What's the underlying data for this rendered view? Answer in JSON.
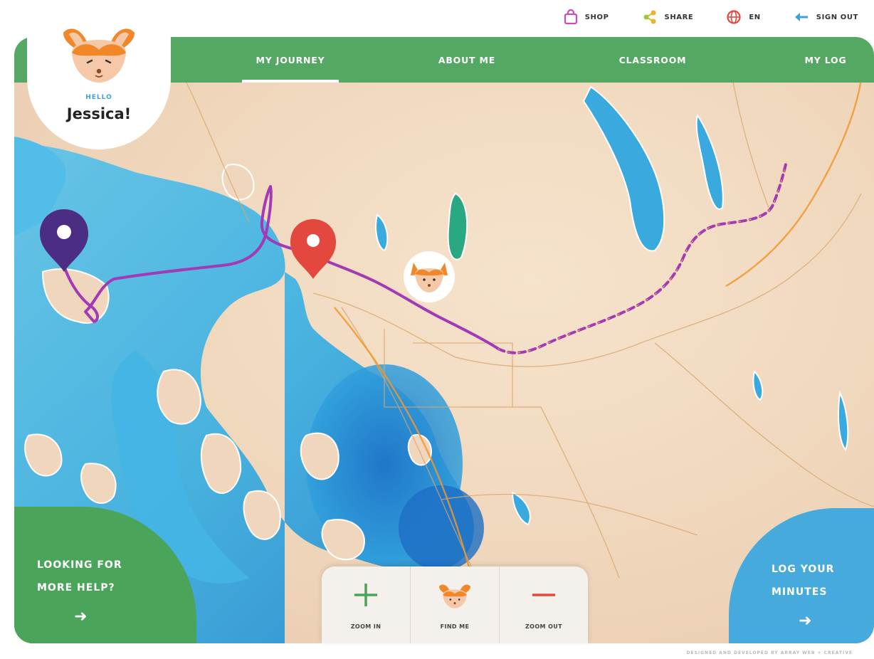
{
  "utility": {
    "shop_label": "SHOP",
    "share_label": "SHARE",
    "language_label": "EN",
    "signout_label": "SIGN OUT"
  },
  "nav": {
    "tabs": [
      {
        "label": "MY JOURNEY",
        "active": true
      },
      {
        "label": "ABOUT ME",
        "active": false
      },
      {
        "label": "CLASSROOM",
        "active": false
      },
      {
        "label": "MY LOG",
        "active": false
      }
    ]
  },
  "greeting": {
    "hello": "HELLO",
    "name": "Jessica!"
  },
  "help_cta": {
    "label": "LOOKING FOR\nMORE HELP?",
    "arrow": "➜"
  },
  "log_cta": {
    "label": "LOG YOUR\nMINUTES",
    "arrow": "➜"
  },
  "controls": {
    "zoom_in": "ZOOM IN",
    "find_me": "FIND ME",
    "zoom_out": "ZOOM OUT"
  },
  "credit": "DESIGNED AND DEVELOPED BY ARRAY WEB + CREATIVE",
  "colors": {
    "nav_green": "#54a863",
    "help_green": "#4aa45a",
    "log_blue": "#47aadd",
    "water": "#3fa9de",
    "land": "#f2dcc4",
    "route_purple": "#a23ab5",
    "start_pin": "#4b2e83",
    "current_pin": "#e4473e",
    "fox_orange": "#f2872a"
  },
  "icons": {
    "shop": "shopping-bag-icon",
    "share": "share-icon",
    "language": "globe-icon",
    "signout": "arrow-left-icon",
    "avatar": "fox-avatar-icon",
    "start_marker": "purple-map-pin-icon",
    "current_marker": "red-map-pin-icon",
    "zoom_in": "plus-icon",
    "find_me": "fox-icon",
    "zoom_out": "minus-icon"
  }
}
